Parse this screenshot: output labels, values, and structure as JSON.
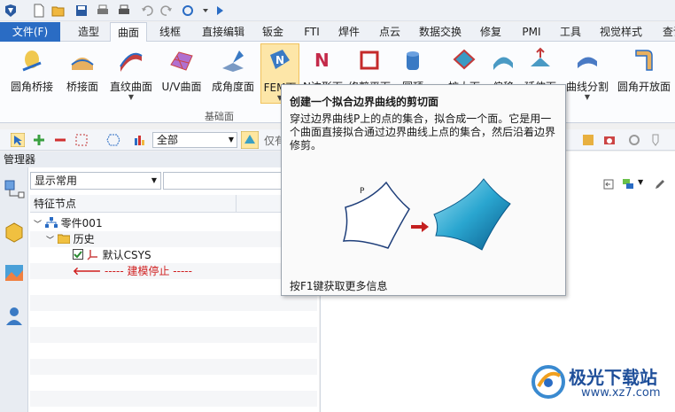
{
  "tabs": {
    "file": "文件(F)",
    "items": [
      "造型",
      "曲面",
      "线框",
      "直接编辑",
      "钣金",
      "FTI",
      "焊件",
      "点云",
      "数据交换",
      "修复",
      "PMI",
      "工具",
      "视觉样式",
      "查询"
    ],
    "active": "曲面"
  },
  "ribbon": {
    "buttons": [
      {
        "label": "圆角桥接",
        "icon": "fillet-bridge-icon",
        "color": "#e8b84a"
      },
      {
        "label": "桥接面",
        "icon": "bridge-surface-icon",
        "color": "#d99a3a"
      },
      {
        "label": "直纹曲面",
        "icon": "ruled-surface-icon",
        "color": "#c34040",
        "dropdown": true
      },
      {
        "label": "U/V曲面",
        "icon": "uv-surface-icon",
        "color": "#a060c0"
      },
      {
        "label": "成角度面",
        "icon": "angled-surface-icon",
        "color": "#3a7ac4"
      },
      {
        "label": "FEM面",
        "icon": "fem-surface-icon",
        "color": "#2a6cc4",
        "dropdown": true,
        "highlighted": true
      },
      {
        "label": "N边形面",
        "icon": "n-sided-surface-icon",
        "color": "#c42a4a"
      },
      {
        "label": "修剪平面",
        "icon": "trim-plane-icon",
        "color": "#c42a2a"
      },
      {
        "label": "圆顶",
        "icon": "dome-icon",
        "color": "#3a7ac4"
      },
      {
        "label": "扩大面",
        "icon": "extend-face-icon",
        "color": "#c43a3a"
      },
      {
        "label": "偏移",
        "icon": "offset-icon",
        "color": "#4a9ac4"
      },
      {
        "label": "延伸面",
        "icon": "stretch-face-icon",
        "color": "#c43a3a"
      },
      {
        "label": "曲线分割",
        "icon": "curve-split-icon",
        "color": "#4a7ac4",
        "dropdown": true
      },
      {
        "label": "圆角开放面",
        "icon": "fillet-open-face-icon",
        "color": "#d99a3a"
      }
    ],
    "group_label": "基础面"
  },
  "toolbar2": {
    "filter_value": "全部",
    "search_hint": "仅有"
  },
  "manager": {
    "title": "管理器",
    "display_select": "显示常用",
    "column_header": "特征节点",
    "tree": {
      "part": "零件001",
      "history": "历史",
      "csys": "默认CSYS",
      "stop": "----- 建模停止 -----"
    }
  },
  "tooltip": {
    "title": "创建一个拟合边界曲线的剪切面",
    "description": "穿过边界曲线P上的点的集合，拟合成一个面。它是用一个曲面直接拟合通过边界曲线上点的集合，然后沿着边界修剪。",
    "diagram_label": "P",
    "footer": "按F1键获取更多信息"
  },
  "watermark": {
    "brand": "极光下载站",
    "url": "www.xz7.com"
  }
}
